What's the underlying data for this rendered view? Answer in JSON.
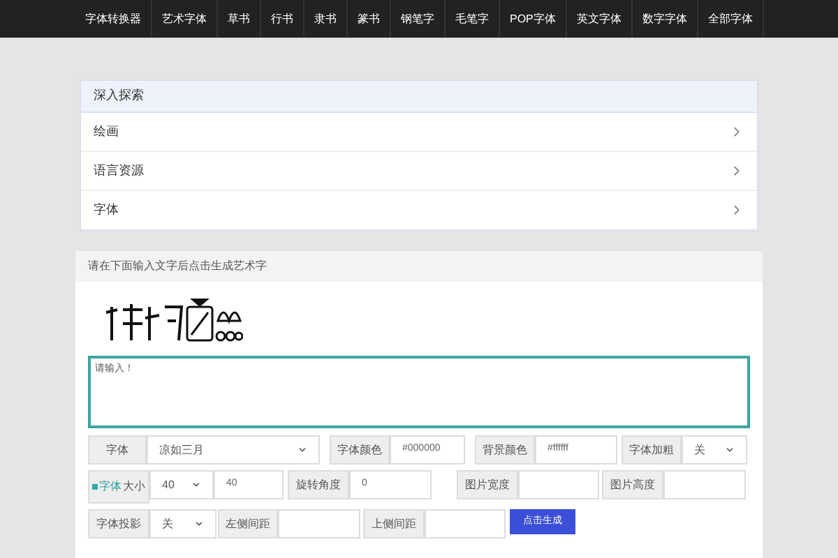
{
  "nav": [
    "字体转换器",
    "艺术字体",
    "草书",
    "行书",
    "隶书",
    "篆书",
    "钢笔字",
    "毛笔字",
    "POP字体",
    "英文字体",
    "数字字体",
    "全部字体"
  ],
  "explore": {
    "title": "深入探索",
    "items": [
      "绘画",
      "语言资源",
      "字体"
    ]
  },
  "generator": {
    "title": "请在下面输入文字后点击生成艺术字",
    "textarea": {
      "placeholder": "请输入！"
    },
    "rows": [
      [
        {
          "kind": "select",
          "label": "字体",
          "value": "凉如三月"
        },
        {
          "kind": "input",
          "label": "字体颜色",
          "value": "#000000"
        },
        {
          "kind": "input",
          "label": "背景颜色",
          "value": "#ffffff"
        },
        {
          "kind": "select",
          "label": "字体加粗",
          "value": "关"
        }
      ],
      [
        {
          "kind": "size",
          "link": "字体",
          "label": "大小",
          "value": "40",
          "value2": "40"
        },
        {
          "kind": "input",
          "label": "旋转角度",
          "value": "0"
        },
        {
          "kind": "input",
          "label": "图片宽度"
        },
        {
          "kind": "input",
          "label": "图片高度"
        }
      ],
      [
        {
          "kind": "select",
          "label": "字体投影",
          "value": "关"
        },
        {
          "kind": "input",
          "label": "左侧间距"
        },
        {
          "kind": "input",
          "label": "上侧间距"
        },
        {
          "kind": "button",
          "label": "点击生成"
        }
      ]
    ]
  }
}
